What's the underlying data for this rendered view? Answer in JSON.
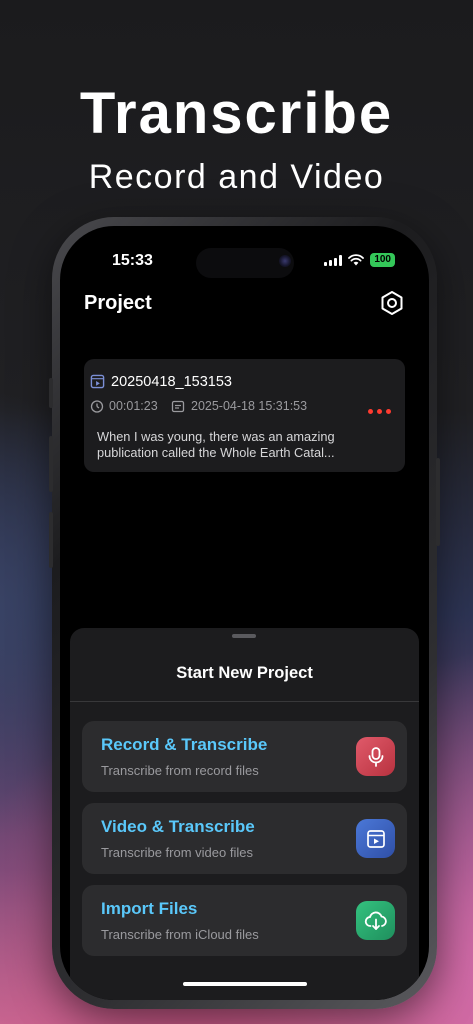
{
  "hero": {
    "title": "Transcribe",
    "subtitle": "Record and Video"
  },
  "status_bar": {
    "time": "15:33",
    "battery": "100"
  },
  "nav": {
    "title": "Project",
    "settings_icon": "gear-icon"
  },
  "projects": [
    {
      "name": "20250418_153153",
      "duration": "00:01:23",
      "date": "2025-04-18 15:31:53",
      "excerpt": "When I was young, there was an amazing publication called the Whole Earth Catal..."
    }
  ],
  "sheet": {
    "title": "Start New Project",
    "options": [
      {
        "title": "Record & Transcribe",
        "subtitle": "Transcribe from record files",
        "icon": "microphone-icon",
        "color": "#d2485a"
      },
      {
        "title": "Video & Transcribe",
        "subtitle": "Transcribe from video files",
        "icon": "video-icon",
        "color": "#3e66c6"
      },
      {
        "title": "Import Files",
        "subtitle": "Transcribe from iCloud files",
        "icon": "cloud-download-icon",
        "color": "#2aa772"
      }
    ]
  },
  "colors": {
    "accent_text": "#5ac8fa",
    "more_dots": "#ff3b30",
    "battery": "#34c759"
  }
}
